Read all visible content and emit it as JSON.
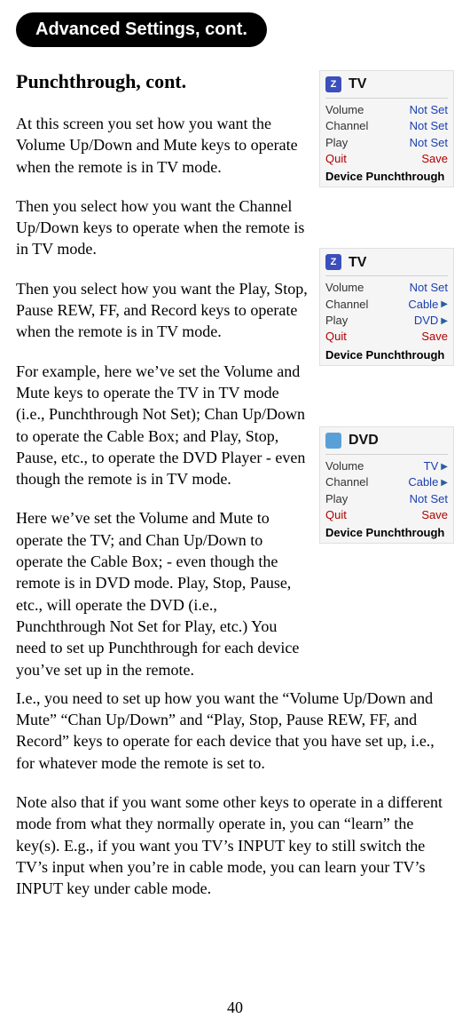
{
  "header": "Advanced Settings, cont.",
  "heading": "Punchthrough, cont.",
  "paragraphs": {
    "p1": "At this screen you set how you want the Volume Up/Down and Mute keys to operate when the remote is in TV mode.",
    "p2": "Then you select how you want the Channel Up/Down keys to operate when the remote is in TV mode.",
    "p3": "Then you select how you want the Play, Stop, Pause REW, FF, and Record keys to operate when the remote is in TV mode.",
    "p4": "For example, here we’ve set the Volume and Mute keys to operate the TV in TV mode (i.e., Punchthrough Not Set); Chan Up/Down to operate the Cable Box; and Play, Stop, Pause, etc., to operate the DVD Player - even though the remote is in TV mode.",
    "p5": "Here we’ve set the Volume and Mute to operate the TV; and Chan Up/Down to operate the Cable Box; - even though the remote is in DVD mode. Play, Stop, Pause, etc., will operate the DVD (i.e., Punchthrough Not Set for Play, etc.) You need to set up Punchthrough for each device you’ve set up in the remote.",
    "p6": "I.e., you need to set up how you want the “Volume Up/Down and Mute” “Chan Up/Down” and “Play, Stop, Pause REW, FF, and Record” keys to operate for each device that you have set up, i.e., for whatever mode the remote is set to.",
    "p7": "Note also that if you want some other keys to operate in a different mode from what they normally operate in, you can “learn” the key(s). E.g., if you want you TV’s INPUT key to still switch the TV’s input when you’re in cable mode, you can learn your TV’s INPUT key under cable mode."
  },
  "screens": {
    "footer": "Device Punchthrough",
    "labels": {
      "volume": "Volume",
      "channel": "Channel",
      "play": "Play",
      "quit": "Quit",
      "save": "Save",
      "notset": "Not Set"
    },
    "s1": {
      "device": "TV",
      "volume": "Not Set",
      "channel": "Not Set",
      "play": "Not Set"
    },
    "s2": {
      "device": "TV",
      "volume": "Not Set",
      "channel": "Cable",
      "play": "DVD"
    },
    "s3": {
      "device": "DVD",
      "volume": "TV",
      "channel": "Cable",
      "play": "Not Set"
    }
  },
  "pageNumber": "40"
}
